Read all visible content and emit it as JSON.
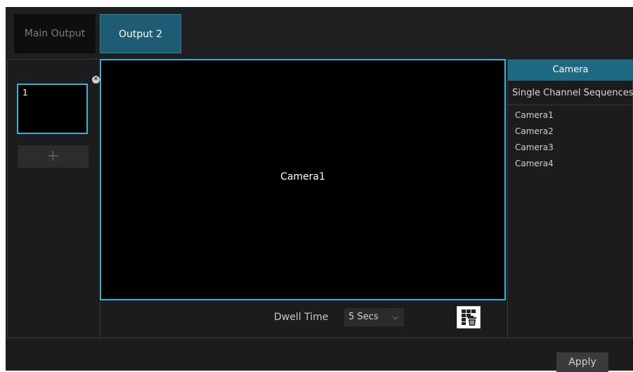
{
  "tabs": [
    {
      "label": "Main Output",
      "active": false
    },
    {
      "label": "Output 2",
      "active": true
    }
  ],
  "sequence": {
    "items": [
      {
        "number": "1"
      }
    ],
    "close_symbol": "✕",
    "add_symbol": "+"
  },
  "preview": {
    "label": "Camera1"
  },
  "dwell": {
    "label": "Dwell Time",
    "value": "5 Secs",
    "chevron": "⌵"
  },
  "camera_panel": {
    "header": "Camera",
    "sequence_title": "Single Channel Sequences",
    "cameras": [
      "Camera1",
      "Camera2",
      "Camera3",
      "Camera4"
    ]
  },
  "footer": {
    "apply_label": "Apply"
  },
  "colors": {
    "accent": "#2bb4d4",
    "active_tab": "#1e5c73",
    "header": "#1e6a85"
  },
  "icons": {
    "layout_button": "grid-trash-icon",
    "close": "close-icon",
    "add": "plus-icon"
  }
}
